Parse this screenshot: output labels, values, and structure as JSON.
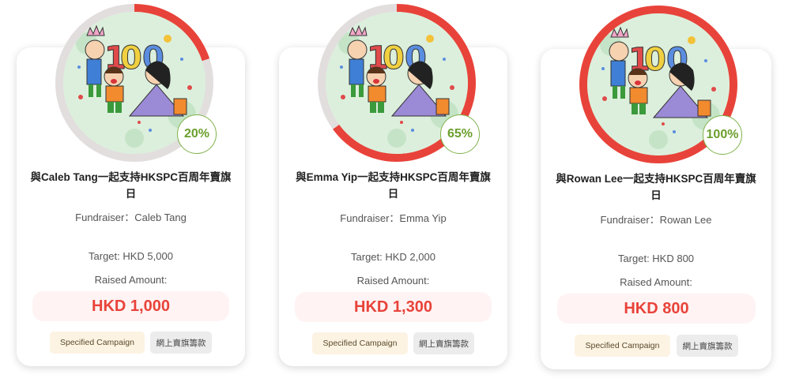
{
  "colors": {
    "accent": "#e8433a",
    "track": "#e2dede",
    "badge_text": "#6b9e2d",
    "badge_border": "#7fb24a"
  },
  "cards": [
    {
      "percent": 20,
      "percent_label": "20%",
      "title_line1": "與Caleb Tang一起支持HKSPC百周年賣旗",
      "title_line2": "日",
      "fundraiser": "Fundraiser：Caleb Tang",
      "target": "Target: HKD 5,000",
      "raised_label": "Raised Amount:",
      "raised": "HKD 1,000",
      "tag1": "Specified Campaign",
      "tag2": "網上賣旗籌款",
      "image_text": "100"
    },
    {
      "percent": 65,
      "percent_label": "65%",
      "title_line1": "與Emma Yip一起支持HKSPC百周年賣旗",
      "title_line2": "日",
      "fundraiser": "Fundraiser：Emma Yip",
      "target": "Target: HKD 2,000",
      "raised_label": "Raised Amount:",
      "raised": "HKD 1,300",
      "tag1": "Specified Campaign",
      "tag2": "網上賣旗籌款",
      "image_text": "100"
    },
    {
      "percent": 100,
      "percent_label": "100%",
      "title_line1": "與Rowan Lee一起支持HKSPC百周年賣旗",
      "title_line2": "日",
      "fundraiser": "Fundraiser：Rowan Lee",
      "target": "Target: HKD 800",
      "raised_label": "Raised Amount:",
      "raised": "HKD 800",
      "tag1": "Specified Campaign",
      "tag2": "網上賣旗籌款",
      "image_text": "100"
    }
  ]
}
